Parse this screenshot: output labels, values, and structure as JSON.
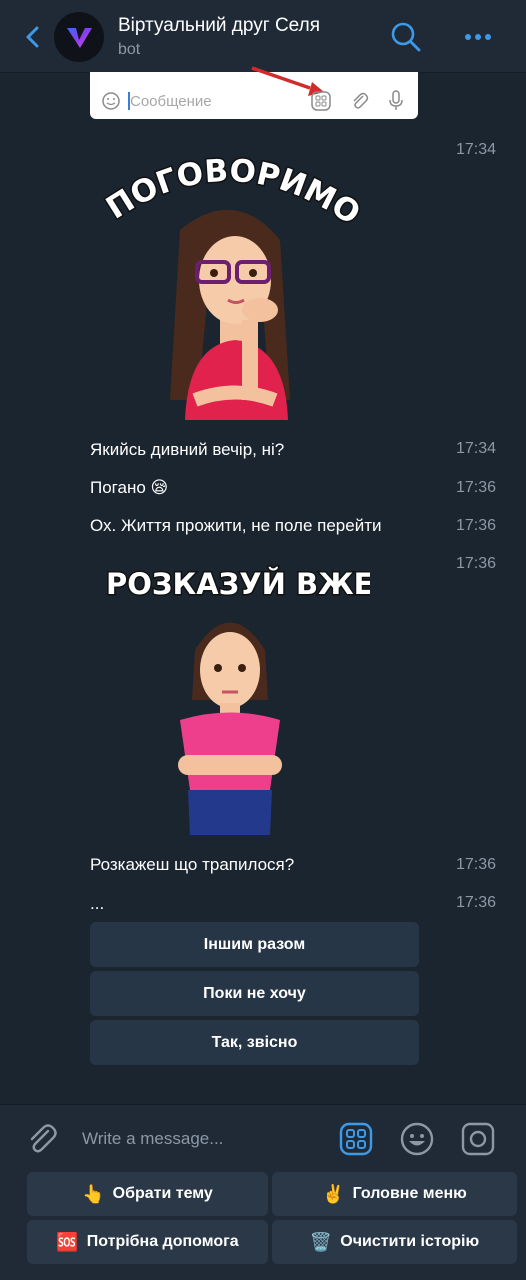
{
  "header": {
    "title": "Віртуальний друг Селя",
    "subtitle": "bot",
    "accent": "#3d9ae8"
  },
  "chat": {
    "screenshot": {
      "placeholder": "Сообщение"
    },
    "sticker1": {
      "time": "17:34",
      "text": "ПОГОВОРИМО?"
    },
    "messages": [
      {
        "text": "Якийсь дивний вечір, ні?",
        "time": "17:34"
      },
      {
        "text": "Погано 😪",
        "time": "17:36"
      },
      {
        "text": "Ох. Життя прожити, не поле перейти",
        "time": "17:36"
      }
    ],
    "sticker2": {
      "time": "17:36",
      "text": "РОЗКАЗУЙ ВЖЕ!"
    },
    "messages2": [
      {
        "text": "Розкажеш що трапилося?",
        "time": "17:36"
      },
      {
        "text": "...",
        "time": "17:36"
      }
    ],
    "inline_buttons": [
      "Іншим разом",
      "Поки не хочу",
      "Так, звісно"
    ]
  },
  "input": {
    "placeholder": "Write a message..."
  },
  "keyboard": {
    "buttons": [
      {
        "emoji": "👆",
        "label": "Обрати тему"
      },
      {
        "emoji": "✌️",
        "label": "Головне меню"
      },
      {
        "emoji": "🆘",
        "label": "Потрібна допомога"
      },
      {
        "emoji": "🗑️",
        "label": "Очистити історію"
      }
    ]
  }
}
